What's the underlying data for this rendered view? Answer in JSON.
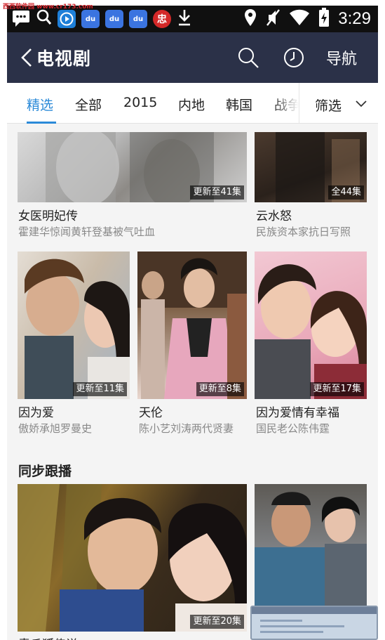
{
  "watermark": "西西软件园 www.cr173.com",
  "statusbar": {
    "time": "3:29",
    "icons": [
      "chat-icon",
      "search-icon",
      "video-app-icon",
      "baidu-icon",
      "baidu-icon",
      "baidu-icon",
      "app-icon",
      "download-icon",
      "location-icon",
      "mute-icon",
      "wifi-icon",
      "battery-icon"
    ],
    "app_badges": [
      "du",
      "du",
      "du",
      "忠"
    ]
  },
  "header": {
    "title": "电视剧",
    "nav_label": "导航",
    "bg_color": "#2b3148"
  },
  "tabs": {
    "items": [
      "精选",
      "全部",
      "2015",
      "内地",
      "韩国",
      "战争"
    ],
    "active_index": 0,
    "filter_label": "筛选",
    "accent_color": "#2b8ad8"
  },
  "shows": [
    {
      "title": "女医明妃传",
      "subtitle": "霍建华惊闻黄轩登基被气吐血",
      "badge": "更新至41集"
    },
    {
      "title": "云水怒",
      "subtitle": "民族资本家抗日写照",
      "badge": "全44集"
    },
    {
      "title": "因为爱",
      "subtitle": "傲娇承旭罗曼史",
      "badge": "更新至11集"
    },
    {
      "title": "天伦",
      "subtitle": "陈小艺刘涛两代贤妻",
      "badge": "更新至8集"
    },
    {
      "title": "因为爱情有幸福",
      "subtitle": "国民老公陈伟霆",
      "badge": "更新至17集"
    }
  ],
  "sync_section": {
    "title": "同步跟播",
    "items": [
      {
        "title": "青丘狐传说",
        "badge": "更新至20集"
      },
      {
        "title": "",
        "badge": ""
      }
    ]
  }
}
